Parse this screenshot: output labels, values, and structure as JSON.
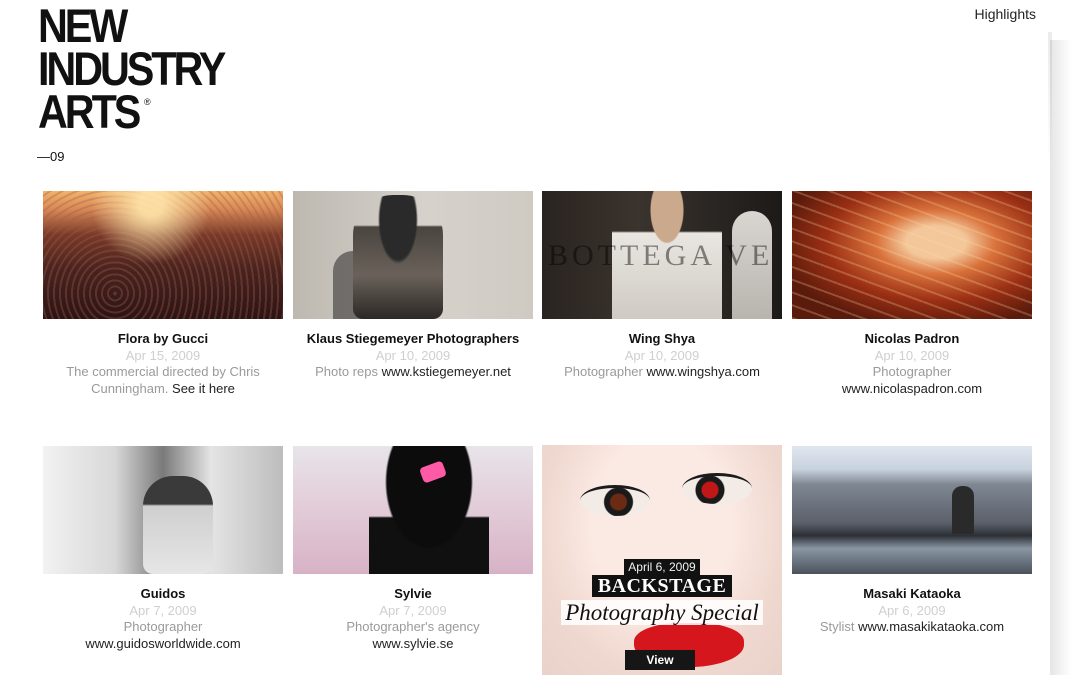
{
  "header": {
    "logo_lines": [
      "NEW",
      "INDUSTRY",
      "ARTS"
    ],
    "logo_mark": "®",
    "edition": "—09",
    "nav_link": "Highlights"
  },
  "cards": [
    {
      "title": "Flora by Gucci",
      "date": "Apr 15, 2009",
      "desc": "The commercial directed by Chris Cunningham.",
      "link": "See it here"
    },
    {
      "title": "Klaus Stiegemeyer Photographers",
      "date": "Apr 10, 2009",
      "desc": "Photo reps",
      "link": "www.kstiegemeyer.net"
    },
    {
      "title": "Wing Shya",
      "date": "Apr 10, 2009",
      "desc": "Photographer",
      "link": "www.wingshya.com",
      "thumb_text": "BOTTEGA VE"
    },
    {
      "title": "Nicolas Padron",
      "date": "Apr 10, 2009",
      "desc": "Photographer",
      "link": "www.nicolaspadron.com"
    },
    {
      "title": "Guidos",
      "date": "Apr 7, 2009",
      "desc": "Photographer",
      "link": "www.guidosworldwide.com"
    },
    {
      "title": "Sylvie",
      "date": "Apr 7, 2009",
      "desc": "Photographer's agency",
      "link": "www.sylvie.se"
    },
    {
      "title": "Masaki Kataoka",
      "date": "Apr 6, 2009",
      "desc": "Stylist",
      "link": "www.masakikataoka.com"
    }
  ],
  "feature": {
    "date": "April 6, 2009",
    "title": "BACKSTAGE",
    "subtitle": "Photography Special",
    "button": "View"
  }
}
